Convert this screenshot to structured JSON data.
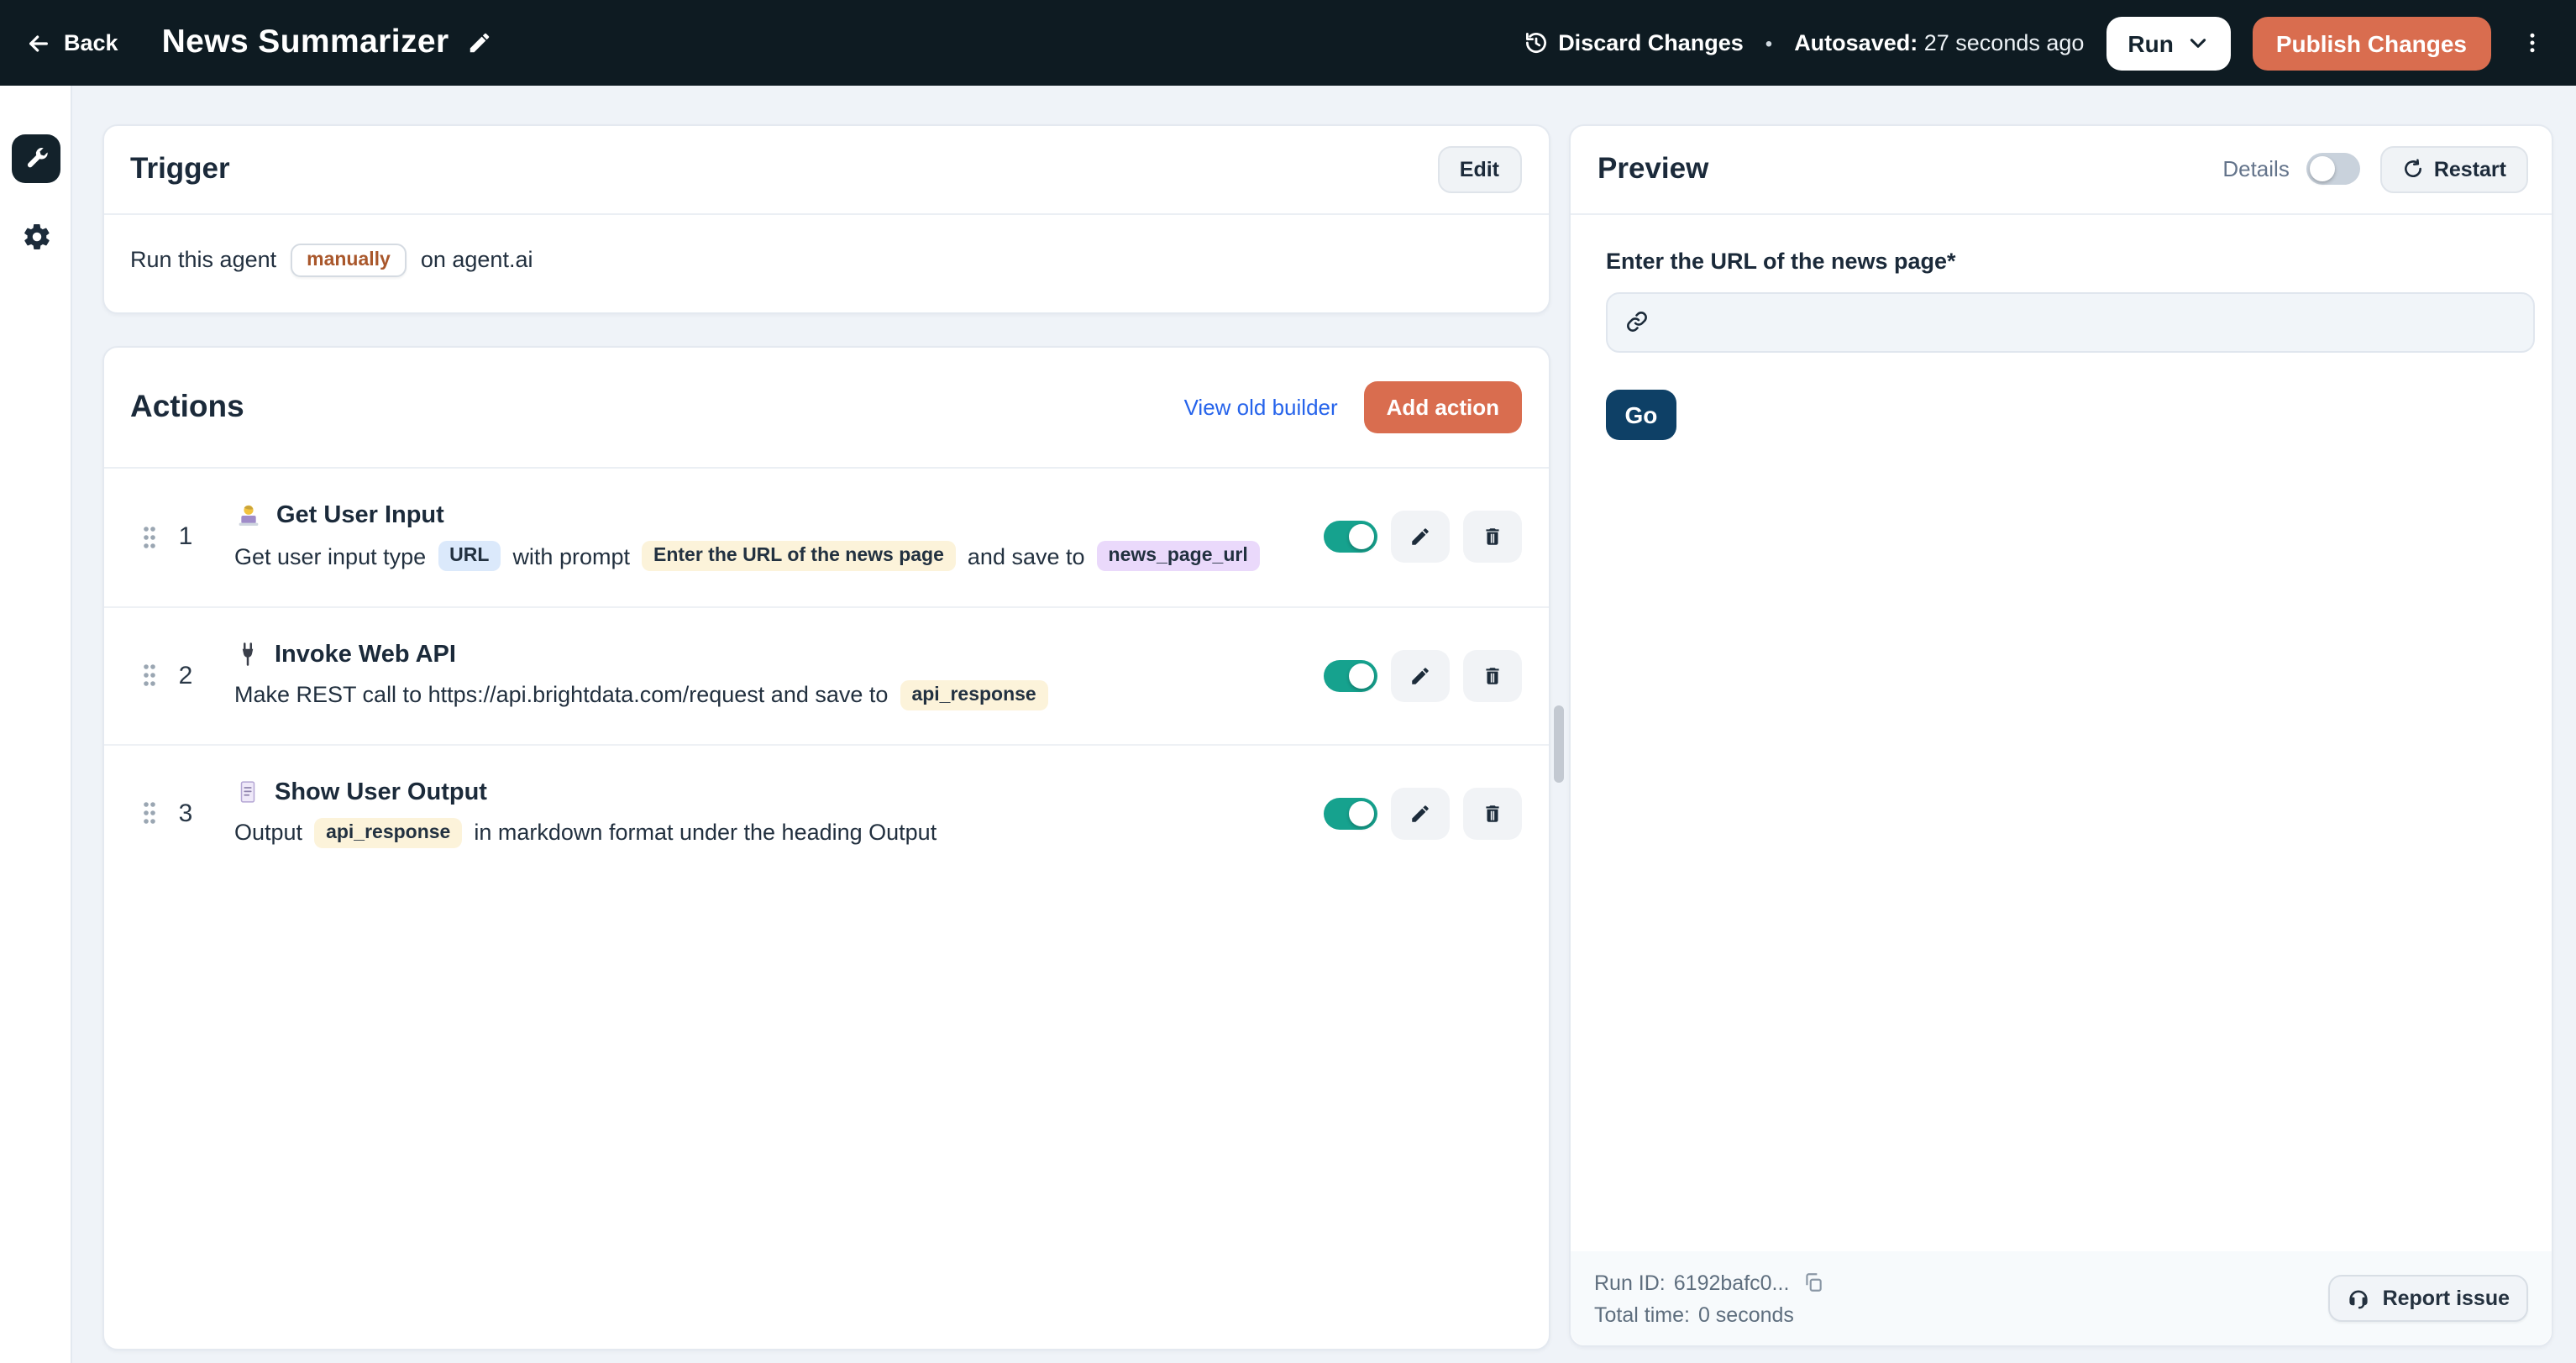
{
  "header": {
    "back_label": "Back",
    "title": "News Summarizer",
    "discard_label": "Discard Changes",
    "separator": "•",
    "autosaved_label": "Autosaved:",
    "autosaved_value": "27 seconds ago",
    "run_label": "Run",
    "publish_label": "Publish Changes"
  },
  "trigger": {
    "title": "Trigger",
    "edit_label": "Edit",
    "sentence_prefix": "Run this agent",
    "mode_chip": "manually",
    "sentence_suffix": "on agent.ai"
  },
  "actions": {
    "title": "Actions",
    "view_old_builder_label": "View old builder",
    "add_action_label": "Add action",
    "items": [
      {
        "number": "1",
        "icon": "person-technologist",
        "title": "Get User Input",
        "desc": {
          "t1": "Get user input type",
          "c1": "URL",
          "t2": "with prompt",
          "c2": "Enter the URL of the news page",
          "t3": "and save to",
          "c3": "news_page_url"
        },
        "enabled": true
      },
      {
        "number": "2",
        "icon": "electric-plug",
        "title": "Invoke Web API",
        "desc": {
          "t1": "Make REST call to https://api.brightdata.com/request and save to",
          "c1": "api_response"
        },
        "enabled": true
      },
      {
        "number": "3",
        "icon": "page-facing-up",
        "title": "Show User Output",
        "desc": {
          "t1": "Output",
          "c1": "api_response",
          "t2": "in markdown format under the heading Output"
        },
        "enabled": true
      }
    ]
  },
  "preview": {
    "title": "Preview",
    "details_label": "Details",
    "details_on": false,
    "restart_label": "Restart",
    "form": {
      "label": "Enter the URL of the news page*",
      "input_value": "",
      "go_label": "Go"
    },
    "footer": {
      "run_id_label": "Run ID:",
      "run_id_value": "6192bafc0...",
      "total_time_label": "Total time:",
      "total_time_value": "0 seconds",
      "report_issue_label": "Report issue"
    }
  },
  "colors": {
    "topbar": "#0e1b22",
    "accent_orange": "#d96d4f",
    "toggle_teal": "#16a28e",
    "go_navy": "#0e4066",
    "link_blue": "#2563eb"
  },
  "icons": {
    "back": "arrow-left",
    "edit_title": "pencil",
    "discard": "history-clock",
    "run_menu": "chevron-down",
    "overflow": "kebab-menu",
    "rail_active": "wrench",
    "rail_settings": "gear",
    "row_reorder": "drag-handle",
    "row_edit": "pencil",
    "row_delete": "trash",
    "url_field": "link-chain",
    "restart": "rotate-arrow",
    "run_id_copy": "copy",
    "report_issue": "headset"
  }
}
